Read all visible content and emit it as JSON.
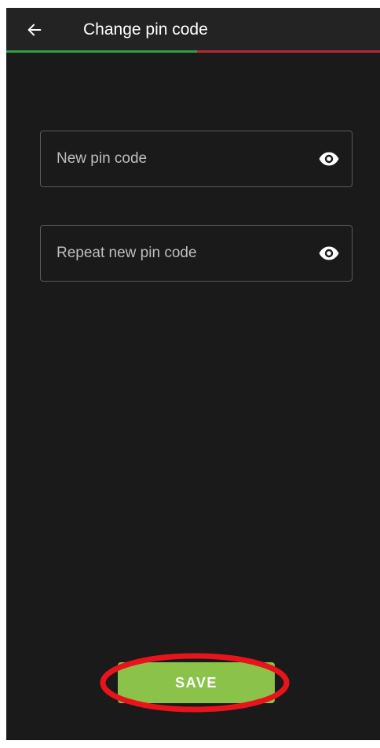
{
  "header": {
    "title": "Change pin code",
    "back_icon": "arrow-left-icon"
  },
  "progress": {
    "fraction": 0.51,
    "fill_color": "#2ea043",
    "track_color": "#b42a32"
  },
  "form": {
    "new_pin": {
      "value": "",
      "placeholder": "New pin code",
      "toggle_icon": "eye-icon"
    },
    "repeat_pin": {
      "value": "",
      "placeholder": "Repeat new pin code",
      "toggle_icon": "eye-icon"
    }
  },
  "actions": {
    "save_label": "SAVE",
    "save_color": "#8bc34a",
    "highlight_color": "#e8141c"
  }
}
